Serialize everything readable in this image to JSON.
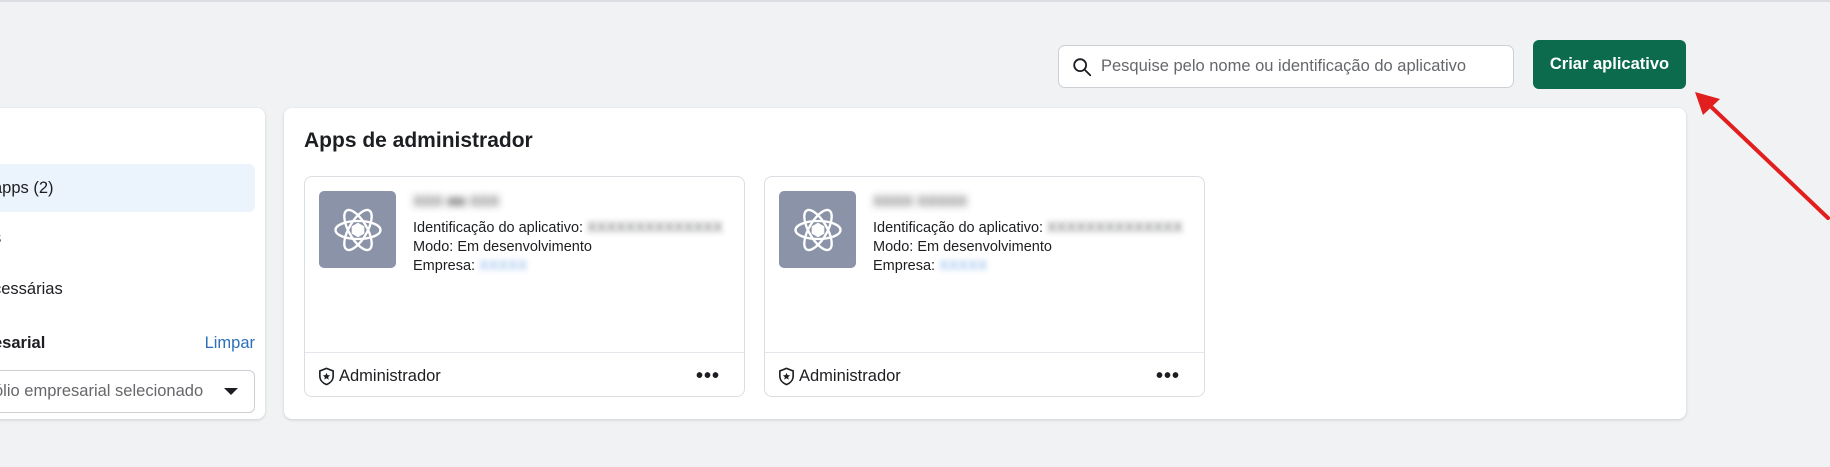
{
  "search": {
    "placeholder": "Pesquise pelo nome ou identificação do aplicativo",
    "icon": "search-icon"
  },
  "create_button": {
    "label": "Criar aplicativo"
  },
  "sidebar": {
    "items": [
      {
        "label": "apps (2)",
        "active": true
      },
      {
        "label": "s",
        "active": false
      },
      {
        "label": "cessárias",
        "active": false
      }
    ],
    "section": {
      "title": "esarial",
      "link": "Limpar"
    },
    "select": {
      "value": "ólio empresarial selecionado"
    }
  },
  "main": {
    "title": "Apps de administrador",
    "apps": [
      {
        "name": "XXX ■■ XXX",
        "id_label": "Identificação do aplicativo:",
        "id_value": "XXXXXXXXXXXXXX",
        "mode_label": "Modo: Em desenvolvimento",
        "company_label": "Empresa:",
        "company_value": "XXXXX",
        "role": "Administrador",
        "more": "•••"
      },
      {
        "name": "XXXX XXXXX",
        "id_label": "Identificação do aplicativo:",
        "id_value": "XXXXXXXXXXXXXX",
        "mode_label": "Modo: Em desenvolvimento",
        "company_label": "Empresa:",
        "company_value": "XXXXX",
        "role": "Administrador",
        "more": "•••"
      }
    ]
  },
  "colors": {
    "accent_button": "#0c6b4c",
    "link": "#2d6fb8",
    "active_item_bg": "#ebf3fc",
    "annotation_arrow": "#e21f1f"
  }
}
